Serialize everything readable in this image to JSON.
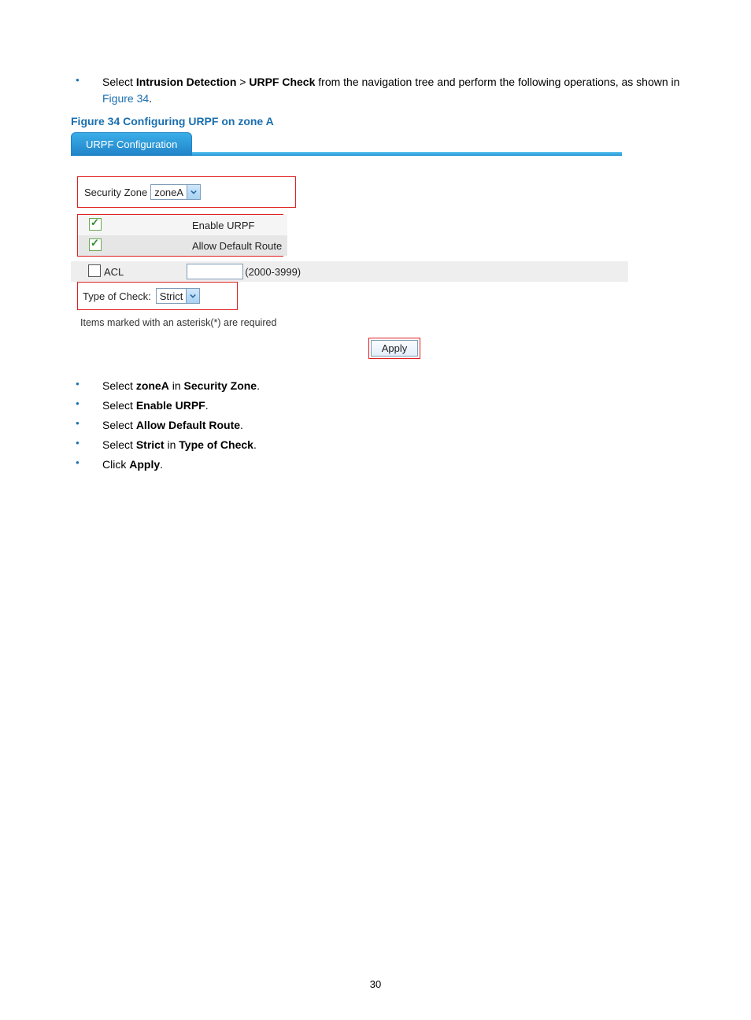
{
  "intro": {
    "pre": "Select ",
    "b1": "Intrusion Detection",
    "gt": " > ",
    "b2": "URPF Check",
    "post": " from the navigation tree and perform the following operations, as shown in ",
    "figref": "Figure 34",
    "period": "."
  },
  "figure_caption": "Figure 34 Configuring URPF on zone A",
  "tab_label": "URPF Configuration",
  "form": {
    "security_zone_label": "Security Zone",
    "security_zone_value": "zoneA",
    "enable_urpf": "Enable URPF",
    "allow_default_route": "Allow Default Route",
    "acl_label": "ACL",
    "acl_range": "(2000-3999)",
    "type_of_check_label": "Type of Check:",
    "type_of_check_value": "Strict",
    "required_note": "Items marked with an asterisk(*) are required",
    "apply": "Apply"
  },
  "steps": [
    {
      "pre": "Select ",
      "b1": "zoneA",
      "mid": " in ",
      "b2": "Security Zone",
      "post": "."
    },
    {
      "pre": "Select ",
      "b1": "Enable URPF",
      "mid": "",
      "b2": "",
      "post": "."
    },
    {
      "pre": "Select ",
      "b1": "Allow Default Route",
      "mid": "",
      "b2": "",
      "post": "."
    },
    {
      "pre": "Select ",
      "b1": "Strict",
      "mid": " in ",
      "b2": "Type of Check",
      "post": "."
    },
    {
      "pre": "Click ",
      "b1": "Apply",
      "mid": "",
      "b2": "",
      "post": "."
    }
  ],
  "page_number": "30"
}
